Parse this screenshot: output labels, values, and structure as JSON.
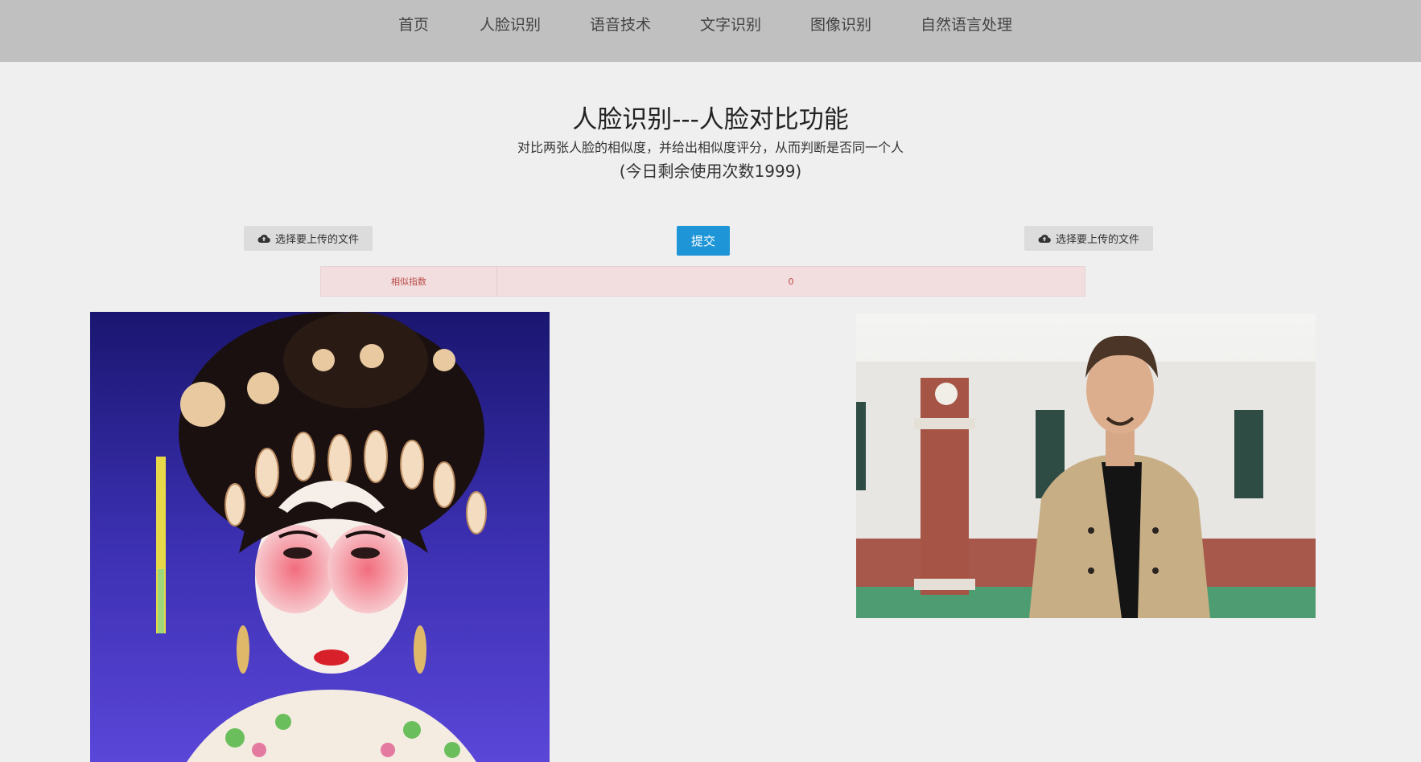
{
  "nav": {
    "items": [
      "首页",
      "人脸识别",
      "语音技术",
      "文字识别",
      "图像识别",
      "自然语言处理"
    ]
  },
  "header": {
    "title": "人脸识别---人脸对比功能",
    "description": "对比两张人脸的相似度，并给出相似度评分，从而判断是否同一个人",
    "remaining": "(今日剩余使用次数1999)"
  },
  "upload": {
    "left_label": "选择要上传的文件",
    "right_label": "选择要上传的文件",
    "icon": "cloud-upload-icon"
  },
  "submit_label": "提交",
  "result": {
    "label": "相似指数",
    "value": "0"
  },
  "images": {
    "left": "opera-performer-portrait",
    "right": "man-in-trench-coat-photo"
  },
  "colors": {
    "nav_bg": "#c0c0c0",
    "page_bg": "#efefef",
    "submit_bg": "#1d95d6",
    "result_bg": "#f2dede",
    "result_text": "#b94a48"
  }
}
